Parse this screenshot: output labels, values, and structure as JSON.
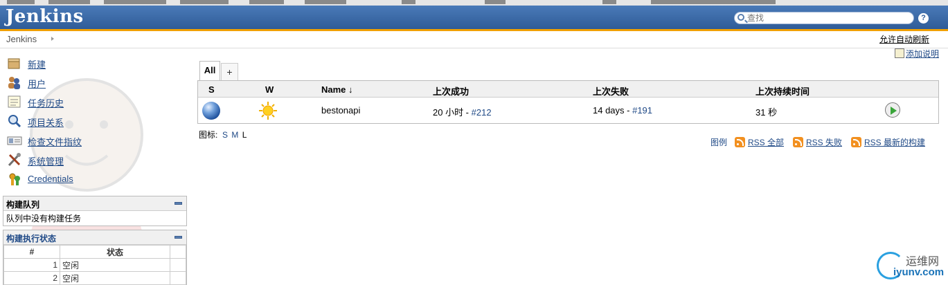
{
  "app": {
    "title": "Jenkins"
  },
  "search": {
    "placeholder": "查找",
    "value": ""
  },
  "help": {
    "label": "?"
  },
  "breadcrumb": {
    "items": [
      "Jenkins"
    ]
  },
  "top_links": {
    "auto_refresh": "允许自动刷新",
    "add_description": "添加说明"
  },
  "sidebar": {
    "tasks": [
      {
        "label": "新建",
        "icon": "new-item-icon"
      },
      {
        "label": "用户",
        "icon": "people-icon"
      },
      {
        "label": "任务历史",
        "icon": "notepad-icon"
      },
      {
        "label": "项目关系",
        "icon": "search-icon"
      },
      {
        "label": "检查文件指纹",
        "icon": "fingerprint-icon"
      },
      {
        "label": "系统管理",
        "icon": "tools-icon"
      },
      {
        "label": "Credentials",
        "icon": "credentials-icon"
      }
    ],
    "build_queue": {
      "title": "构建队列",
      "empty": "队列中没有构建任务"
    },
    "executors": {
      "title": "构建执行状态",
      "headers": [
        "#",
        "状态"
      ],
      "rows": [
        {
          "num": "1",
          "status": "空闲"
        },
        {
          "num": "2",
          "status": "空闲"
        }
      ]
    }
  },
  "view": {
    "tabs": [
      {
        "label": "All",
        "active": true
      },
      {
        "label": "+"
      }
    ],
    "columns": {
      "s": "S",
      "w": "W",
      "name": "Name ↓",
      "last_success": "上次成功",
      "last_failure": "上次失败",
      "last_duration": "上次持续时间"
    },
    "jobs": [
      {
        "status_icon": "blue-ball-icon",
        "weather_icon": "sunny-weather-icon",
        "name": "bestonapi",
        "last_success_time": "20 小时 - ",
        "last_success_build": "#212",
        "last_failure_time": "14 days - ",
        "last_failure_build": "#191",
        "last_duration": "31 秒"
      }
    ]
  },
  "icon_size": {
    "label": "图标:",
    "sizes": [
      "S",
      "M",
      "L"
    ]
  },
  "feeds": {
    "legend": "图例",
    "rss_all": "RSS 全部",
    "rss_failed": "RSS 失败",
    "rss_latest": "RSS 最新的构建"
  },
  "watermark": {
    "line1": "运维网",
    "line2": "iyunv.com"
  },
  "colors": {
    "header": "#3a6aa8",
    "accent": "#f0a000",
    "link": "#204A87",
    "rss": "#f29020"
  }
}
